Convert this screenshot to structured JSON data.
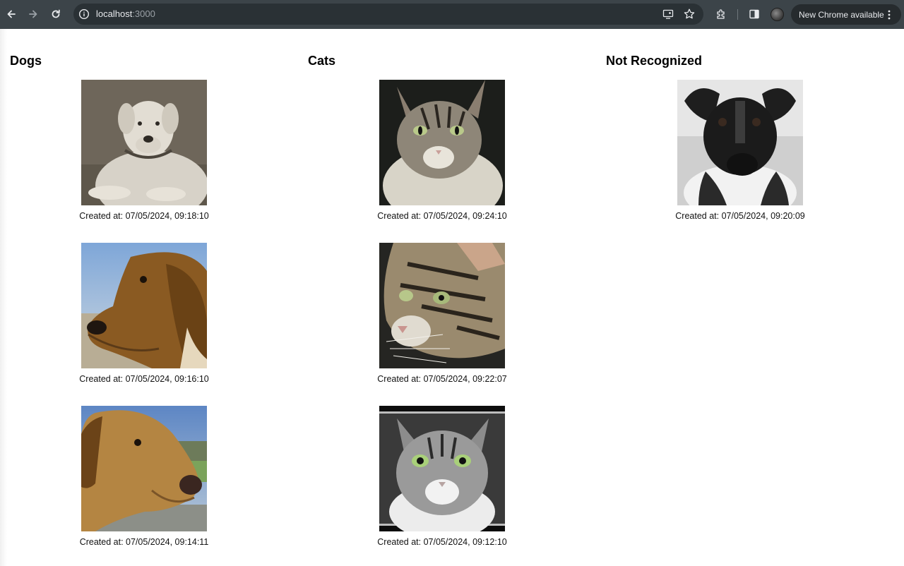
{
  "browser": {
    "url_host": "localhost",
    "url_port": ":3000",
    "update_label": "New Chrome available",
    "icons": [
      "back-arrow-icon",
      "forward-arrow-icon",
      "reload-icon",
      "info-icon",
      "cast-icon",
      "star-icon",
      "extensions-icon",
      "side-panel-icon",
      "profile-avatar",
      "more-vert-icon"
    ]
  },
  "columns": [
    {
      "title": "Dogs",
      "items": [
        {
          "caption": "Created at: 07/05/2024, 09:18:10",
          "subject": "white labrador dog, sepia photo"
        },
        {
          "caption": "Created at: 07/05/2024, 09:16:10",
          "subject": "brown dog profile, blue sky"
        },
        {
          "caption": "Created at: 07/05/2024, 09:14:11",
          "subject": "tan dog profile, green field"
        }
      ]
    },
    {
      "title": "Cats",
      "items": [
        {
          "caption": "Created at: 07/05/2024, 09:24:10",
          "subject": "tabby cat with green eyes"
        },
        {
          "caption": "Created at: 07/05/2024, 09:22:07",
          "subject": "tabby cat close-up side view"
        },
        {
          "caption": "Created at: 07/05/2024, 09:12:10",
          "subject": "black and white tabby cat portrait"
        }
      ]
    },
    {
      "title": "Not Recognized",
      "items": [
        {
          "caption": "Created at: 07/05/2024, 09:20:09",
          "subject": "black and white dog, monochrome photo"
        }
      ]
    }
  ],
  "colors": {
    "toolbar": "#3c4449",
    "omnibox": "#2a3135",
    "page_background": "#ffffff"
  }
}
